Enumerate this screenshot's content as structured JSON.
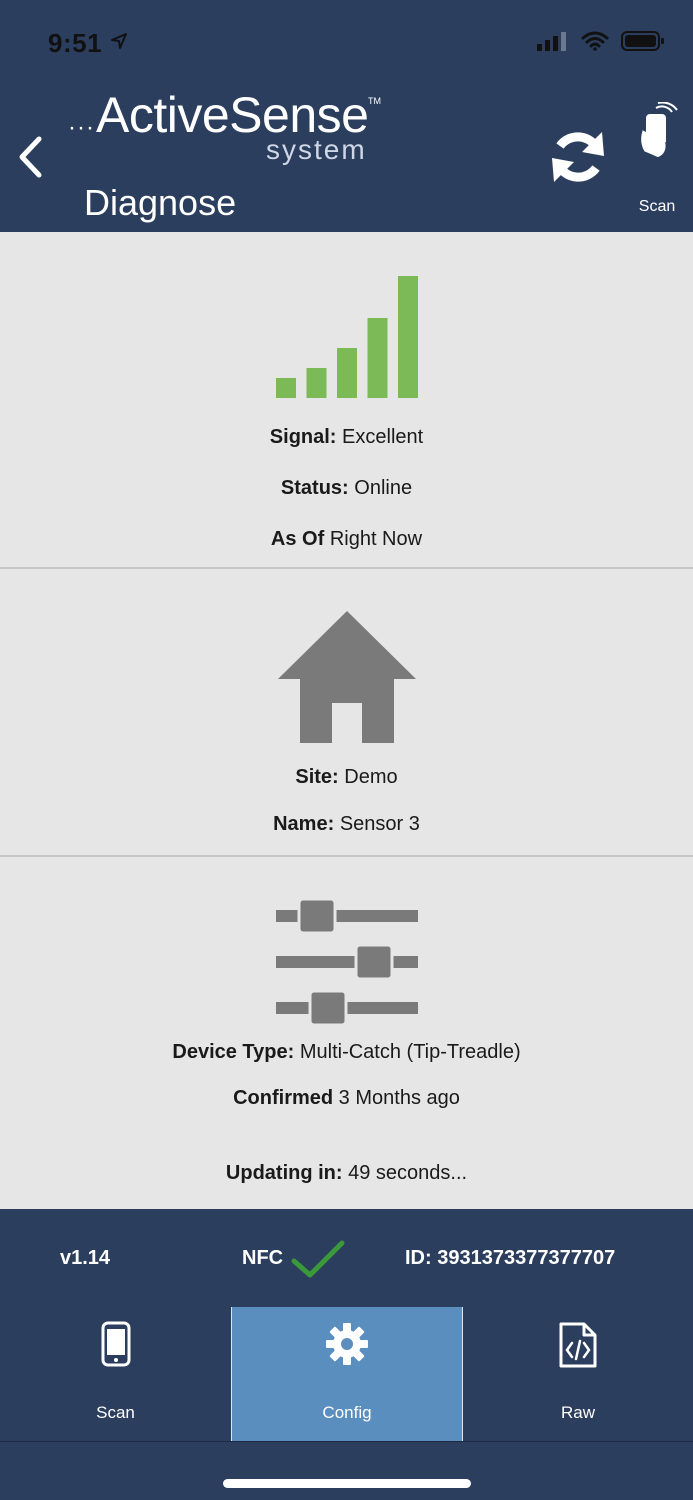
{
  "status_bar": {
    "time": "9:51"
  },
  "header": {
    "logo_text": "ActiveSense",
    "logo_tm": "TM",
    "logo_sub": "system",
    "title": "Diagnose",
    "scan_label": "Scan"
  },
  "signal": {
    "bars_filled": 5,
    "bars_total": 5,
    "color": "#7cba57",
    "signal_label": "Signal:",
    "signal_value": "Excellent",
    "status_label": "Status:",
    "status_value": "Online",
    "asof_label": "As Of",
    "asof_value": "Right Now"
  },
  "site": {
    "site_label": "Site:",
    "site_value": "Demo",
    "name_label": "Name:",
    "name_value": "Sensor 3"
  },
  "device": {
    "type_label": "Device Type:",
    "type_value": "Multi-Catch (Tip-Treadle)",
    "confirmed_label": "Confirmed",
    "confirmed_value": "3 Months ago",
    "updating_label": "Updating in:",
    "updating_value": "49 seconds..."
  },
  "infobar": {
    "version": "v1.14",
    "nfc_label": "NFC",
    "nfc_ok_color": "#3a9a3a",
    "id_label": "ID:",
    "id_value": "3931373377377707"
  },
  "tabs": [
    {
      "label": "Scan",
      "icon": "phone-icon",
      "active": false
    },
    {
      "label": "Config",
      "icon": "gear-icon",
      "active": true
    },
    {
      "label": "Raw",
      "icon": "code-file-icon",
      "active": false
    }
  ],
  "colors": {
    "header_bg": "#2c3e5e",
    "content_bg": "#e6e6e6",
    "tab_active_bg": "#5a8ebf",
    "icon_gray": "#7a7a7a"
  }
}
